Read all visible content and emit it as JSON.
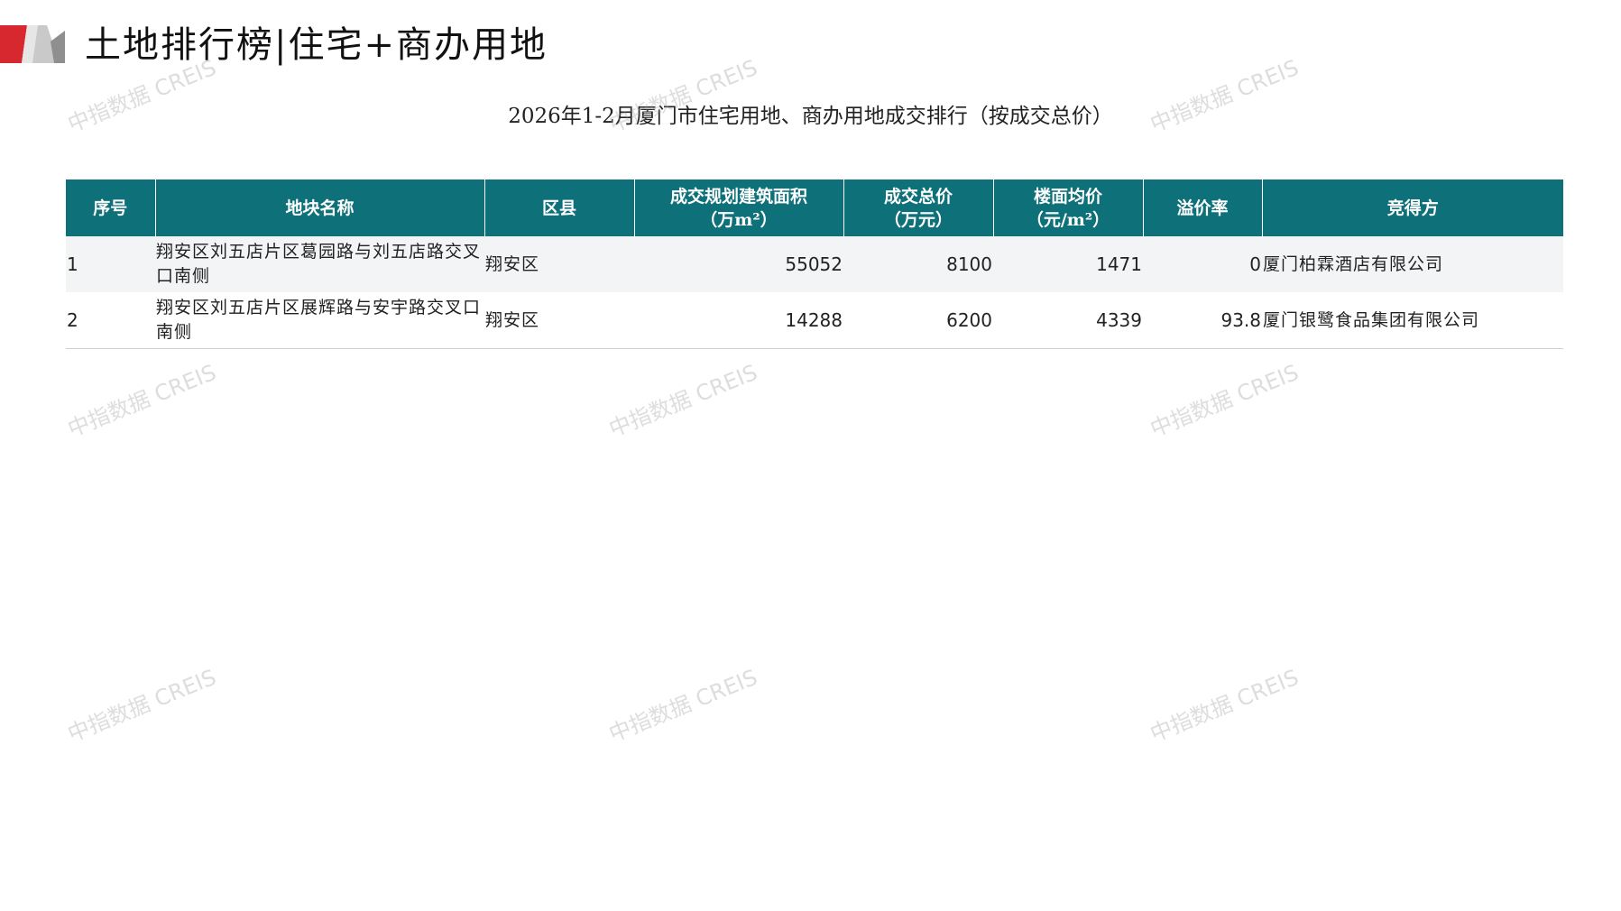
{
  "header": {
    "title": "土地排行榜|住宅+商办用地"
  },
  "caption": "2026年1-2月厦门市住宅用地、商办用地成交排行（按成交总价）",
  "table": {
    "columns": [
      {
        "line1": "序号",
        "line2": ""
      },
      {
        "line1": "地块名称",
        "line2": ""
      },
      {
        "line1": "区县",
        "line2": ""
      },
      {
        "line1": "成交规划建筑面积",
        "line2": "（万m²）"
      },
      {
        "line1": "成交总价",
        "line2": "（万元）"
      },
      {
        "line1": "楼面均价",
        "line2": "（元/m²）"
      },
      {
        "line1": "溢价率",
        "line2": ""
      },
      {
        "line1": "竞得方",
        "line2": ""
      }
    ],
    "rows": [
      {
        "index": "1",
        "parcel": "翔安区刘五店片区葛园路与刘五店路交叉口南侧",
        "district": "翔安区",
        "area": "55052",
        "total_price": "8100",
        "unit_price": "1471",
        "premium": "0",
        "winner": "厦门柏霖酒店有限公司"
      },
      {
        "index": "2",
        "parcel": "翔安区刘五店片区展辉路与安宇路交叉口南侧",
        "district": "翔安区",
        "area": "14288",
        "total_price": "6200",
        "unit_price": "4339",
        "premium": "93.8",
        "winner": "厦门银鹭食品集团有限公司"
      }
    ]
  },
  "watermark": {
    "text": "中指数据 CREIS"
  },
  "colors": {
    "header_bg": "#0e7079",
    "price_red": "#c00000",
    "logo_red": "#d7282f",
    "logo_gray": "#b5b5b5"
  }
}
